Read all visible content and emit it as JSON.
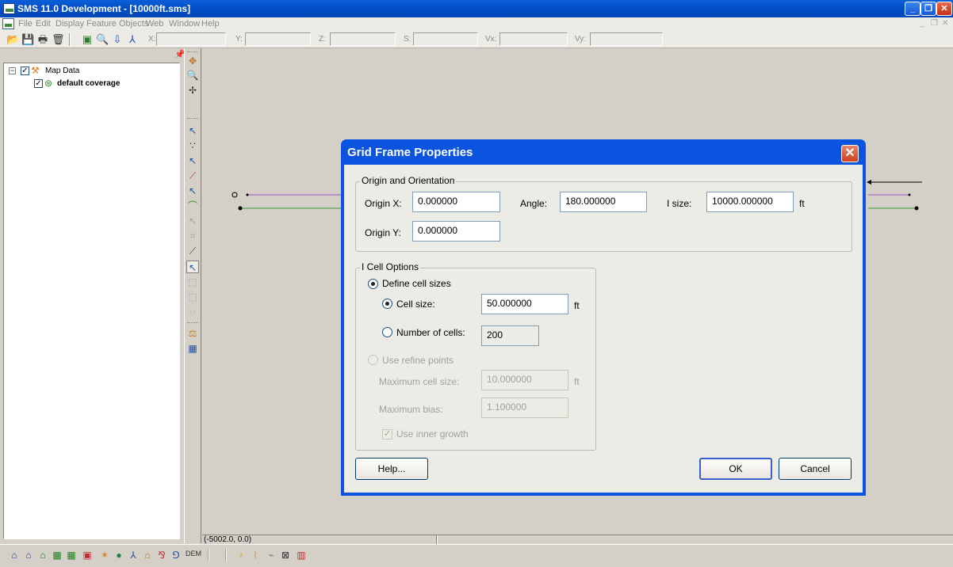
{
  "window": {
    "title": "SMS 11.0 Development - [10000ft.sms]",
    "buttons": {
      "minimize": "_",
      "restore": "❐",
      "close": "✕"
    }
  },
  "menu": {
    "items": [
      "File",
      "Edit",
      "Display",
      "Feature Objects",
      "Web",
      "Window",
      "Help"
    ],
    "mdi_controls": [
      "_",
      "❐",
      "✕"
    ]
  },
  "toolbar": {
    "coord_labels": [
      "X:",
      "Y:",
      "Z:",
      "S:",
      "Vx:",
      "Vy:"
    ]
  },
  "tree": {
    "root": {
      "label": "Map Data",
      "checked": true,
      "icon": "map-data-icon"
    },
    "children": [
      {
        "label": "default coverage",
        "checked": true,
        "icon": "coverage-icon"
      }
    ]
  },
  "status": {
    "coordinates": "(-5002.0, 0.0)"
  },
  "bottom": {
    "dem_label": "DEM"
  },
  "dialog": {
    "title": "Grid Frame Properties",
    "close": "✕",
    "origin_group": {
      "legend": "Origin and Orientation",
      "origin_x_label": "Origin X:",
      "origin_x_value": "0.000000",
      "angle_label": "Angle:",
      "angle_value": "180.000000",
      "isize_label": "I size:",
      "isize_value": "10000.000000",
      "isize_unit": "ft",
      "origin_y_label": "Origin Y:",
      "origin_y_value": "0.000000"
    },
    "cell_group": {
      "legend": "I Cell Options",
      "define_sizes": {
        "label": "Define cell sizes",
        "selected": true
      },
      "cell_size": {
        "label": "Cell size:",
        "value": "50.000000",
        "unit": "ft",
        "selected": true
      },
      "num_cells": {
        "label": "Number of cells:",
        "value": "200",
        "selected": false
      },
      "refine_points": {
        "label": "Use refine points",
        "selected": false,
        "enabled": false
      },
      "max_cell_size": {
        "label": "Maximum cell size:",
        "value": "10.000000",
        "unit": "ft"
      },
      "max_bias": {
        "label": "Maximum bias:",
        "value": "1.100000"
      },
      "inner_growth": {
        "label": "Use inner growth",
        "checked": true,
        "enabled": false
      }
    },
    "buttons": {
      "help": "Help...",
      "ok": "OK",
      "cancel": "Cancel"
    }
  },
  "colors": {
    "title_blue": "#0346b8",
    "dialog_frame": "#0a54e0",
    "arc_purple": "#a050c8",
    "arc_green": "#3a9a3a"
  }
}
